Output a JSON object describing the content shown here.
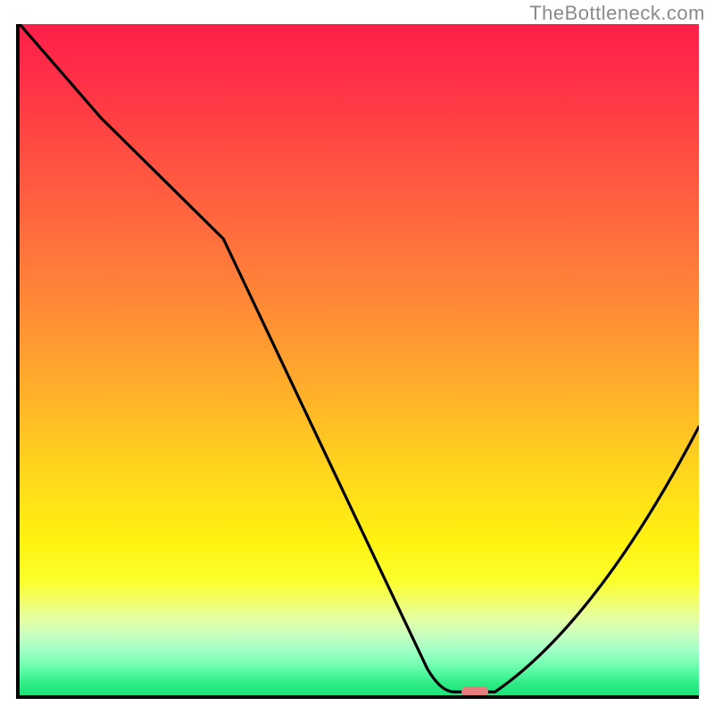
{
  "watermark": "TheBottleneck.com",
  "chart_data": {
    "type": "line",
    "title": "",
    "xlabel": "",
    "ylabel": "",
    "xlim": [
      0,
      100
    ],
    "ylim": [
      0,
      100
    ],
    "grid": false,
    "legend": false,
    "series": [
      {
        "name": "curve",
        "x": [
          0,
          12,
          30,
          60,
          64,
          70,
          100
        ],
        "y": [
          100,
          86,
          68,
          4,
          0.5,
          0.5,
          40
        ]
      }
    ],
    "marker": {
      "x": 67,
      "y": 0.5,
      "color": "#e67d7d"
    },
    "gradient_stops": [
      {
        "pos": 0,
        "color": "#ff1f49"
      },
      {
        "pos": 8,
        "color": "#ff2f47"
      },
      {
        "pos": 18,
        "color": "#ff4a42"
      },
      {
        "pos": 30,
        "color": "#ff6a3e"
      },
      {
        "pos": 42,
        "color": "#ff8a36"
      },
      {
        "pos": 55,
        "color": "#ffb02a"
      },
      {
        "pos": 66,
        "color": "#ffd41d"
      },
      {
        "pos": 77,
        "color": "#fff210"
      },
      {
        "pos": 83,
        "color": "#fbff2c"
      },
      {
        "pos": 88.5,
        "color": "#e6ffa0"
      },
      {
        "pos": 91,
        "color": "#c9ffc0"
      },
      {
        "pos": 93,
        "color": "#a6ffc6"
      },
      {
        "pos": 95,
        "color": "#7effb8"
      },
      {
        "pos": 97,
        "color": "#4bf79a"
      },
      {
        "pos": 98.3,
        "color": "#2ceb85"
      },
      {
        "pos": 100,
        "color": "#1de37a"
      }
    ]
  }
}
